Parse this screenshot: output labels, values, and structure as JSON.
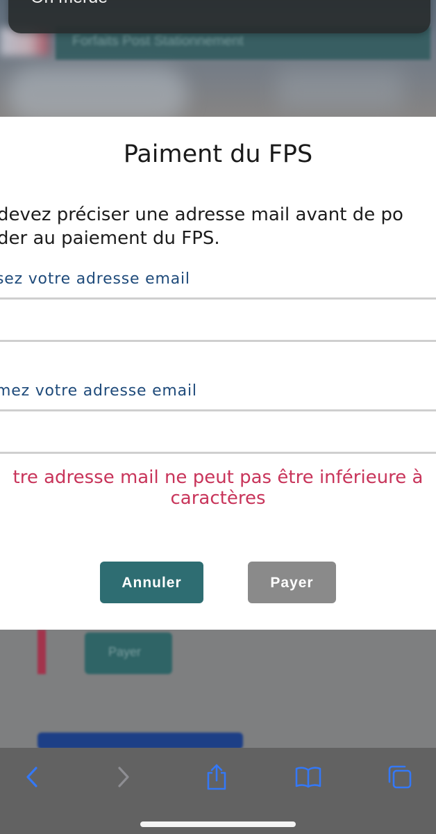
{
  "notification": {
    "text": "Oh merde"
  },
  "background": {
    "banner_text": "Forfaits Post Stationnement",
    "button_label": "Payer"
  },
  "modal": {
    "title": "Paiment du FPS",
    "message_line1": "devez préciser une adresse mail avant de po",
    "message_line2": "der au paiement du FPS.",
    "email_label": "sez votre adresse email",
    "email_value": "",
    "confirm_label": "mez votre adresse email",
    "confirm_value": "",
    "error_line1": "tre adresse mail ne peut pas être inférieure à",
    "error_line2": "caractères",
    "cancel_label": "Annuler",
    "pay_label": "Payer"
  },
  "toolbar": {
    "icons": [
      "back-icon",
      "forward-icon",
      "share-icon",
      "bookmarks-icon",
      "tabs-icon"
    ],
    "active_color": "#3478f6",
    "disabled_color": "#8e8e93"
  },
  "colors": {
    "primary_button": "#2e6d72",
    "disabled_button": "#8a8a8a",
    "label_blue": "#1e4a7a",
    "error_red": "#c8345a"
  }
}
